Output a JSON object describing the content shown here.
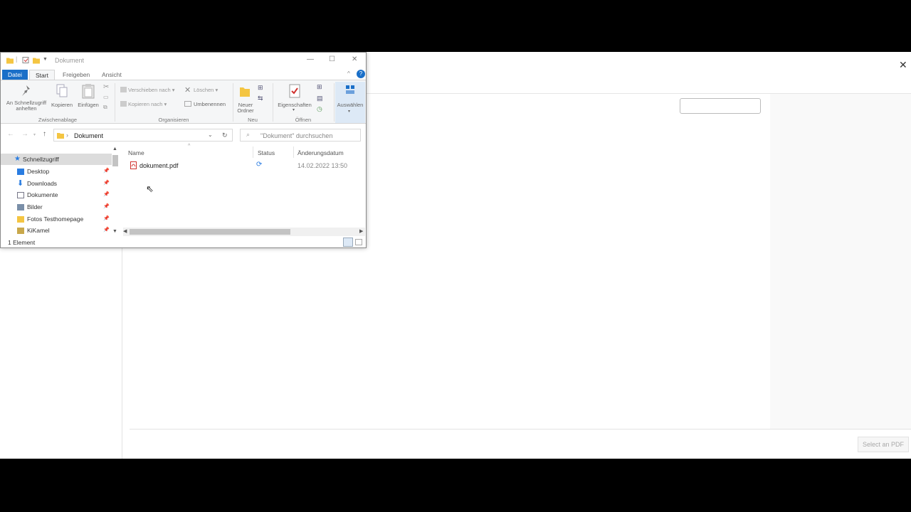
{
  "app": {
    "select_button": "Select an PDF",
    "close_glyph": "✕"
  },
  "explorer": {
    "title": "Dokument",
    "window_controls": {
      "minimize": "—",
      "maximize": "☐",
      "close": "✕"
    },
    "tabs": [
      "Datei",
      "Start",
      "Freigeben",
      "Ansicht"
    ],
    "ribbon": {
      "pin_label": "An Schnellzugriff anheften",
      "copy_label": "Kopieren",
      "paste_label": "Einfügen",
      "move_to_label": "Verschieben nach",
      "copy_to_label": "Kopieren nach",
      "delete_label": "Löschen",
      "rename_label": "Umbenennen",
      "new_folder_label": "Neuer Ordner",
      "properties_label": "Eigenschaften",
      "select_label": "Auswählen",
      "groups": {
        "clipboard": "Zwischenablage",
        "organize": "Organisieren",
        "new": "Neu",
        "open": "Öffnen"
      }
    },
    "address": {
      "path": "Dokument",
      "search_placeholder": "\"Dokument\" durchsuchen"
    },
    "nav_items": [
      {
        "label": "Schnellzugriff",
        "icon": "star-icon"
      },
      {
        "label": "Desktop",
        "icon": "desktop-icon"
      },
      {
        "label": "Downloads",
        "icon": "download-icon"
      },
      {
        "label": "Dokumente",
        "icon": "document-icon"
      },
      {
        "label": "Bilder",
        "icon": "picture-icon"
      },
      {
        "label": "Fotos Testhomepage",
        "icon": "folder-icon"
      },
      {
        "label": "KiKamel",
        "icon": "folder-icon"
      }
    ],
    "columns": {
      "name": "Name",
      "status": "Status",
      "date": "Änderungsdatum"
    },
    "files": [
      {
        "name": "dokument.pdf",
        "date": "14.02.2022 13:50"
      }
    ],
    "status_text": "1 Element",
    "colors": {
      "file_tab": "#1a6fc8",
      "folder": "#f4c542",
      "pdf": "#d0312d"
    }
  }
}
